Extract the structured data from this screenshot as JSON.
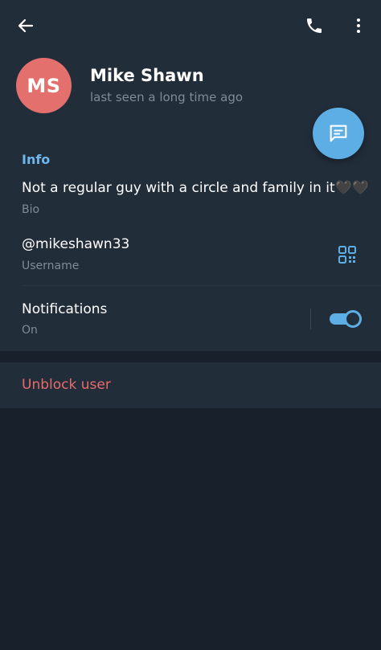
{
  "header": {
    "avatar_initials": "MS",
    "name": "Mike Shawn",
    "status": "last seen a long time ago",
    "icons": {
      "back": "arrow-left-icon",
      "call": "phone-icon",
      "more": "more-vertical-icon",
      "message": "message-icon"
    }
  },
  "info": {
    "title": "Info",
    "bio": {
      "value": "Not a regular guy with a circle and family in it🖤🖤",
      "label": "Bio"
    },
    "username": {
      "value": "@mikeshawn33",
      "label": "Username",
      "icon": "qr-code-icon"
    },
    "notifications": {
      "value": "Notifications",
      "label": "On",
      "enabled": true
    }
  },
  "actions": {
    "unblock_label": "Unblock user"
  },
  "colors": {
    "header_bg": "#222d3a",
    "screen_bg": "#18202b",
    "accent": "#5eaee6",
    "avatar": "#e3706c",
    "danger": "#e96b6b"
  }
}
